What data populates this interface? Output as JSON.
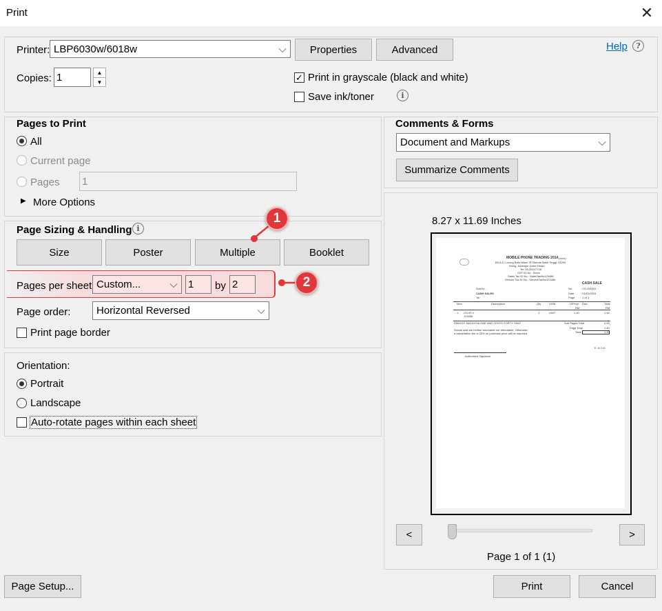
{
  "window": {
    "title": "Print"
  },
  "printer": {
    "label": "Printer:",
    "value": "LBP6030w/6018w",
    "properties_label": "Properties",
    "advanced_label": "Advanced"
  },
  "help": {
    "label": "Help"
  },
  "copies": {
    "label": "Copies:",
    "value": "1"
  },
  "grayscale": {
    "label": "Print in grayscale (black and white)",
    "checked": true
  },
  "save_ink": {
    "label": "Save ink/toner",
    "checked": false
  },
  "pages_to_print": {
    "heading": "Pages to Print",
    "all_label": "All",
    "current_label": "Current page",
    "pages_label": "Pages",
    "pages_value": "1",
    "more_options_label": "More Options"
  },
  "sizing": {
    "heading": "Page Sizing & Handling",
    "size_label": "Size",
    "poster_label": "Poster",
    "multiple_label": "Multiple",
    "booklet_label": "Booklet",
    "pages_per_sheet_label": "Pages per sheet:",
    "pages_per_sheet_value": "Custom...",
    "cols_value": "1",
    "by_label": "by",
    "rows_value": "2",
    "page_order_label": "Page order:",
    "page_order_value": "Horizontal Reversed",
    "print_border_label": "Print page border"
  },
  "orientation": {
    "heading": "Orientation:",
    "portrait_label": "Portrait",
    "landscape_label": "Landscape",
    "autorotate_label": "Auto-rotate pages within each sheet"
  },
  "comments": {
    "heading": "Comments & Forms",
    "value": "Document and Markups",
    "summarize_label": "Summarize Comments"
  },
  "preview": {
    "size_label": "8.27 x 11.69 Inches",
    "page_label": "Page 1 of 1 (1)",
    "prev_label": "<",
    "next_label": ">"
  },
  "doc": {
    "company": "MOBILE PHONE TRADING 2014",
    "company_suffix": "(xxxx)",
    "address1": "B0-8-2, Lorong Batu Nilam 3F Bandar Bukit Tinggi, 41200",
    "address2": "Klang, Selangor Darul Ehsan",
    "tel": "Tel: 03-55247748",
    "gst": "GST ID No : 0xxxx",
    "sales_tax": "Sales Tax ID No : SalesTaxNo123456",
    "service_tax": "Service Tax ID No : ServiceTaxNo123456",
    "heading": "CASH SALE",
    "sold_to": "Sold to :",
    "customer": "CASH SALES",
    "tel_label": "Tel :",
    "no_label": "No.",
    "no_value": ": CS-000031",
    "date_label": "Date",
    "date_value": ": 01/01/2019",
    "page_label": "Page",
    "page_value": ": 1 of 1",
    "col_item": "Item",
    "col_desc": "Description",
    "col_qty": "Qty",
    "col_uom": "UOM",
    "col_price": "U/Price",
    "col_disc": "Disc.",
    "col_total": "Total",
    "col_rm1": "RM",
    "col_rm2": "RM",
    "row_no": "1.",
    "row_item": "OS-95 V",
    "row_item2": "123456",
    "row_qty": "1",
    "row_uom": "UNIT",
    "row_price": "1.40",
    "row_total": "1.40",
    "amount_words": "RINGGIT MALAYSIA ONE AND CENTS FORTY ONLY",
    "subtotal_label": "Sub Pages Total",
    "subtotal_value": "0.00",
    "pagetotal_label": "Page Total",
    "pagetotal_value": "1.40",
    "total_label": "Total",
    "total_value": "1.40",
    "note1": "Goods sold are neither returnable nor refundable. Otherwise",
    "note2": "a cancellation fee of 20% on purchase price will be imposed.",
    "eoe": "E. & O.E.",
    "signature": "Authorised Signature"
  },
  "footer": {
    "page_setup_label": "Page Setup...",
    "print_label": "Print",
    "cancel_label": "Cancel"
  },
  "callouts": {
    "one": "1",
    "two": "2"
  },
  "colors": {
    "callout": "#e0373b",
    "link": "#0066cc"
  }
}
